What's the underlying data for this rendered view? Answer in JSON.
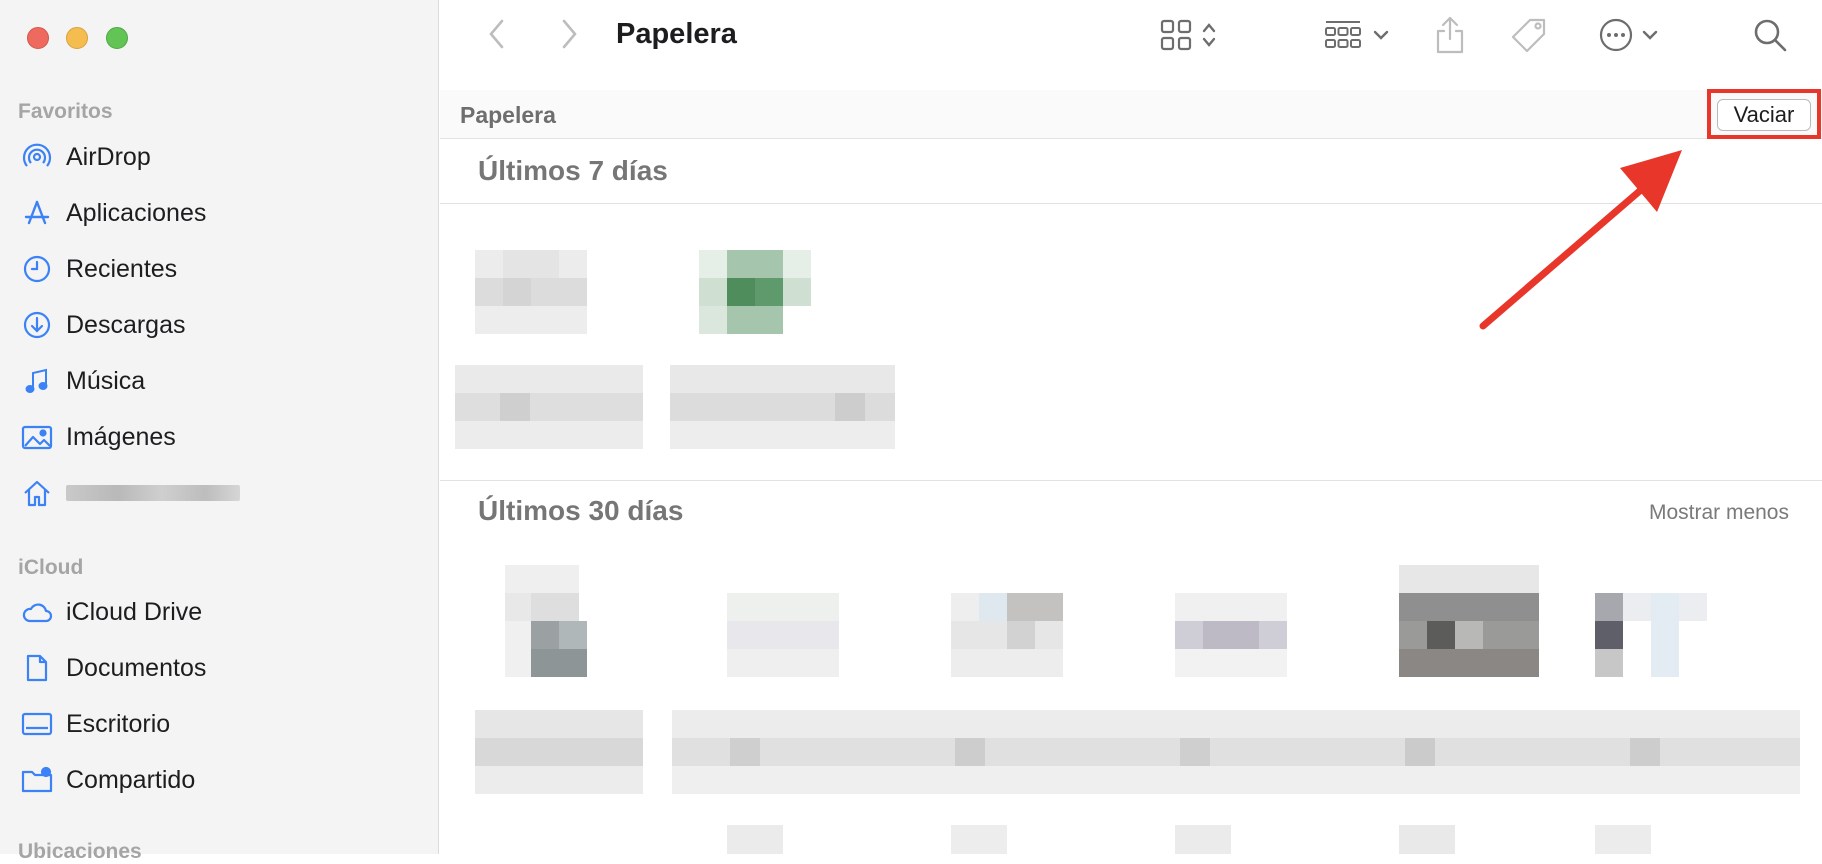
{
  "window": {
    "title": "Papelera"
  },
  "sidebar": {
    "sections": [
      {
        "label": "Favoritos",
        "items": [
          {
            "label": "AirDrop",
            "icon": "airdrop-icon"
          },
          {
            "label": "Aplicaciones",
            "icon": "applications-icon"
          },
          {
            "label": "Recientes",
            "icon": "clock-icon"
          },
          {
            "label": "Descargas",
            "icon": "download-icon"
          },
          {
            "label": "Música",
            "icon": "music-note-icon"
          },
          {
            "label": "Imágenes",
            "icon": "photo-icon"
          },
          {
            "label": "",
            "icon": "home-icon"
          }
        ]
      },
      {
        "label": "iCloud",
        "items": [
          {
            "label": "iCloud Drive",
            "icon": "cloud-icon"
          },
          {
            "label": "Documentos",
            "icon": "document-icon"
          },
          {
            "label": "Escritorio",
            "icon": "desktop-icon"
          },
          {
            "label": "Compartido",
            "icon": "shared-folder-icon"
          }
        ]
      },
      {
        "label": "Ubicaciones",
        "items": []
      }
    ]
  },
  "pathbar": {
    "label": "Papelera",
    "empty_button": "Vaciar"
  },
  "content": {
    "sections": [
      {
        "title": "Últimos 7 días",
        "action": ""
      },
      {
        "title": "Últimos 30 días",
        "action": "Mostrar menos"
      }
    ]
  },
  "colors": {
    "accent": "#3a82f6",
    "annotation": "#e8362a"
  }
}
